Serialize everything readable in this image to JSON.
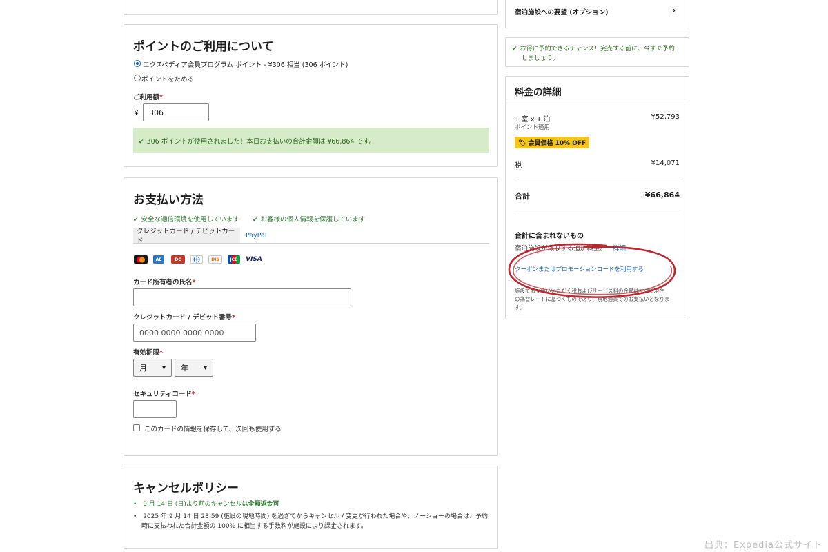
{
  "points": {
    "title": "ポイントのご利用について",
    "option_use": "エクスペディア会員プログラム ポイント - ¥306 相当 (306 ポイント)",
    "option_save": "ポイントをためる",
    "amount_label": "ご利用額",
    "required_mark": "*",
    "currency": "¥",
    "amount_value": "306",
    "success_message": "306 ポイントが使用されました！本日お支払いの合計金額は ¥66,864 です。"
  },
  "payment": {
    "title": "お支払い方法",
    "secure_note": "安全な通信環境を使用しています",
    "privacy_note": "お客様の個人情報を保護しています",
    "tab_card": "クレジットカード / デビットカード",
    "tab_paypal": "PayPal",
    "card_logos": [
      "Mastercard",
      "AMEX",
      "Diners",
      "Discover",
      "Discover",
      "JCB",
      "VISA"
    ],
    "cardholder_label": "カード所有者の氏名",
    "card_number_label": "クレジットカード / デビット番号",
    "card_number_placeholder": "0000 0000 0000 0000",
    "expiry_label": "有効期限",
    "month_option": "月",
    "year_option": "年",
    "cvv_label": "セキュリティコード",
    "save_card_label": "このカードの情報を保存して、次回も使用する"
  },
  "cancel": {
    "title": "キャンセルポリシー",
    "free_cancel_prefix": "9 月 14 日 (日)より前のキャンセルは",
    "free_cancel_bold": "全額返金可",
    "fee_line1": "2025 年 9 月 14 日 23:59 (施設の現地時間) を過ぎてからキャンセル / 変更が行われた場合や、ノーショーの場合は、予約",
    "fee_line2": "時に支払われた合計金額の 100% に相当する手数料が施設により課金されます。"
  },
  "sidebar": {
    "request_label": "宿泊施設への要望 (オプション)",
    "deal_line1": "お得に予約できるチャンス！完売する前に、今すぐ予約",
    "deal_line2": "しましょう。",
    "price_title": "料金の詳細",
    "room_label": "1 室 x 1 泊",
    "room_price": "¥52,793",
    "points_applied": "ポイント適用",
    "member_badge": "会員価格 10% OFF",
    "tax_label": "税",
    "tax_price": "¥14,071",
    "total_label": "合計",
    "total_price": "¥66,864",
    "not_included_title": "合計に含まれないもの",
    "not_included_text": "宿泊施設が徴収する追加料金。",
    "details_link": "詳細",
    "coupon_link": "クーポンまたはプロモーションコードを利用する",
    "fine_print_1": "施設でお支払いいただく税およびサービス料の金額はすべて現在",
    "fine_print_2": "の為替レートに基づくものであり、現地通貨でのお支払いとなりま",
    "fine_print_3": "す。"
  },
  "source_credit": "出典：Expedia公式サイト",
  "colors": {
    "accent_blue": "#1565c0",
    "success_green": "#2e7d32",
    "success_bg": "#d6ecc9",
    "badge_yellow": "#f5c518",
    "annotation_red": "#c0272d"
  }
}
